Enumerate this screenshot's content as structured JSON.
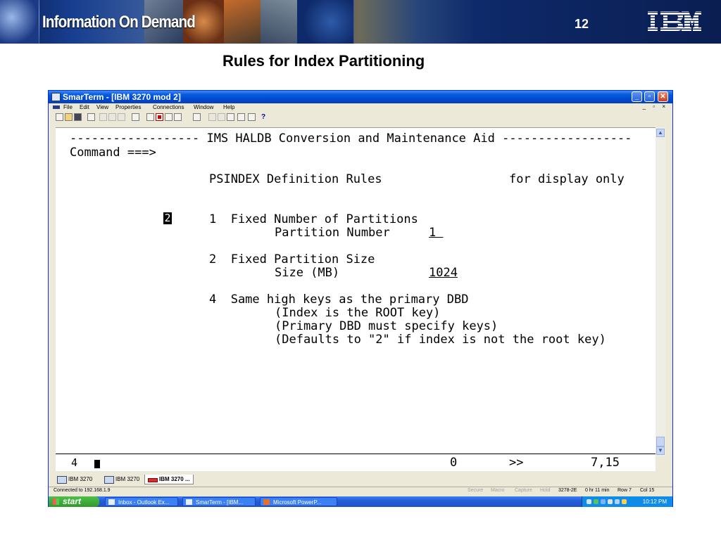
{
  "banner": {
    "title": "Information On Demand",
    "slide_number": "12",
    "logo": "IBM"
  },
  "slide_title": "Rules for Index Partitioning",
  "window": {
    "title": "SmarTerm - [IBM 3270 mod 2]",
    "menu": [
      "File",
      "Edit",
      "View",
      "Properties",
      "Connections",
      "Window",
      "Help"
    ],
    "mdi_controls": "_ ▫ ×",
    "help_button": "?"
  },
  "terminal": {
    "header": "------------------ IMS HALDB Conversion and Maintenance Aid ------------------",
    "command": "Command ===>",
    "screen_title": "PSINDEX Definition Rules",
    "display_note": "for display only",
    "selection_value": "2",
    "opt1": "1  Fixed Number of Partitions",
    "opt1_field": "Partition Number",
    "opt1_value": "1 ",
    "opt2": "2  Fixed Partition Size",
    "opt2_field": "Size (MB)",
    "opt2_value": "1024",
    "opt4": "4  Same high keys as the primary DBD",
    "opt4_l1": "(Index is the ROOT key)",
    "opt4_l2": "(Primary DBD must specify keys)",
    "opt4_l3": "(Defaults to \"2\" if index is not the root key)"
  },
  "oia": {
    "indicator": "4",
    "counter": "0",
    "arrows": ">>",
    "cursor_pos": "7,15"
  },
  "session_tabs": [
    "IBM 3270",
    "IBM 3270",
    "IBM 3270 ..."
  ],
  "statusbar": {
    "connected": "Connected to 192.168.1.9",
    "secure": "Secure",
    "macro": "Macro",
    "capture": "Capture",
    "hold": "Hold",
    "terminal": "3278-2E",
    "timer": "0 hr 11 min",
    "row": "Row 7",
    "col": "Col 15"
  },
  "taskbar": {
    "start": "start",
    "tasks": [
      "Inbox - Outlook Ex...",
      "SmarTerm - [IBM...",
      "Microsoft PowerP..."
    ],
    "clock": "10:12 PM"
  },
  "colors": {
    "accent": "#0a5bdc",
    "banner": "#0b1f55",
    "start_green": "#3aa535",
    "close_red": "#c63f22"
  }
}
